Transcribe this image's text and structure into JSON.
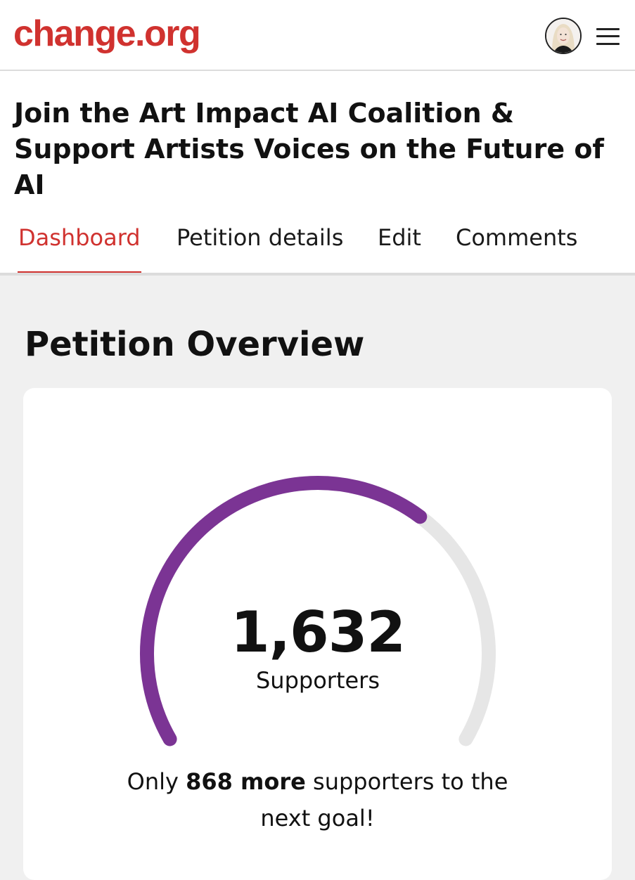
{
  "header": {
    "logo_text": "change.org",
    "brand_color": "#d0322f",
    "avatar_icon": "user-avatar",
    "menu_icon": "hamburger-menu-icon"
  },
  "petition": {
    "title": "Join the Art Impact AI Coalition & Support Artists Voices on the Future of AI"
  },
  "tabs": [
    {
      "label": "Dashboard",
      "active": true
    },
    {
      "label": "Petition details",
      "active": false
    },
    {
      "label": "Edit",
      "active": false
    },
    {
      "label": "Comments",
      "active": false
    }
  ],
  "overview": {
    "title": "Petition Overview",
    "supporter_count": "1,632",
    "supporter_label": "Supporters",
    "progress_fraction": 0.653,
    "progress_color": "#7b3494",
    "track_color": "#e6e6e6",
    "goal_prefix": "Only ",
    "goal_bold": "868 more",
    "goal_suffix": " supporters to the next goal!"
  }
}
